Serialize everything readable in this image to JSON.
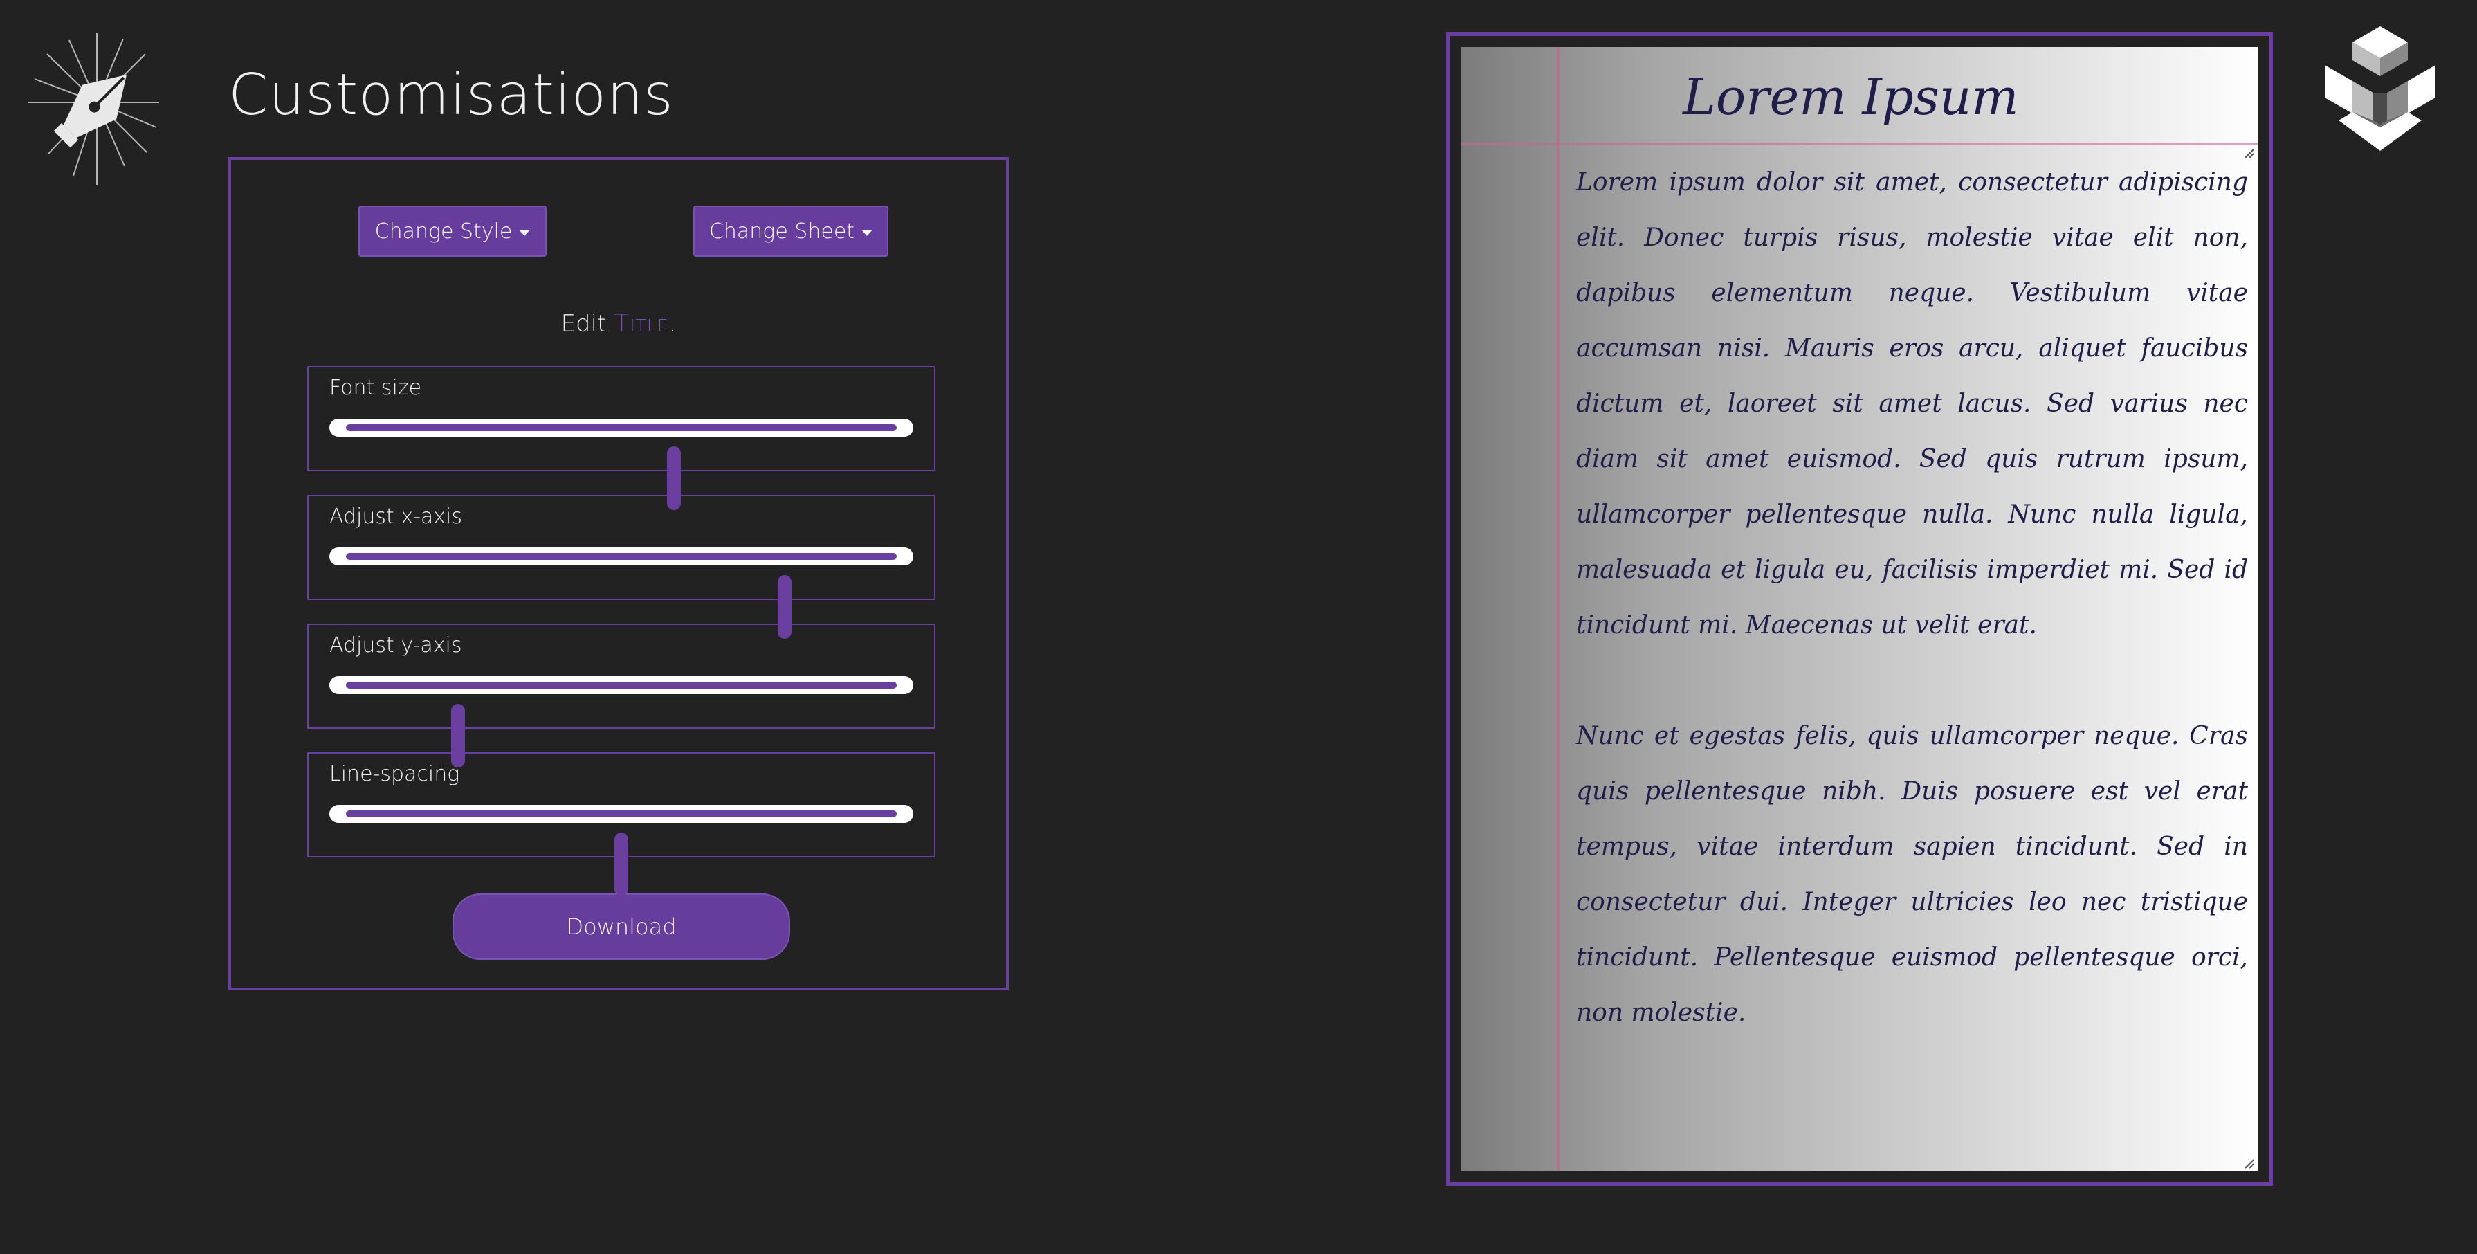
{
  "app": {
    "title": "Customisations",
    "left_logo_icon": "fountain-pen-nib-icon",
    "right_logo_icon": "hexagon-cube-icon"
  },
  "controls": {
    "change_style_label": "Change Style",
    "change_sheet_label": "Change Sheet",
    "edit_prefix": "Edit",
    "edit_title_link": "Title",
    "edit_suffix": ".",
    "download_label": "Download",
    "accent_color": "#663d9d"
  },
  "sliders": [
    {
      "label": "Font size",
      "value": 0.59
    },
    {
      "label": "Adjust x-axis",
      "value": 0.78
    },
    {
      "label": "Adjust y-axis",
      "value": 0.22
    },
    {
      "label": "Line-spacing",
      "value": 0.5
    }
  ],
  "preview": {
    "title": "Lorem Ipsum",
    "paragraphs": [
      "Lorem ipsum dolor sit amet, consectetur adipiscing elit. Donec turpis risus, molestie vitae elit non, dapibus elementum neque. Vestibulum vitae accumsan nisi. Mauris eros arcu, aliquet faucibus dictum et, laoreet sit amet lacus. Sed varius nec diam sit amet euismod. Sed quis rutrum ipsum, ullamcorper pellentesque nulla. Nunc nulla ligula, malesuada et ligula eu, facilisis imperdiet mi. Sed id tincidunt mi. Maecenas ut velit erat.",
      "Nunc et egestas felis, quis ullamcorper neque. Cras quis pellentesque nibh. Duis posuere est vel erat tempus, vitae interdum sapien tincidunt. Sed in consectetur dui. Integer ultricies leo nec tristique tincidunt. Pellentesque euismod pellentesque orci, non molestie."
    ]
  }
}
